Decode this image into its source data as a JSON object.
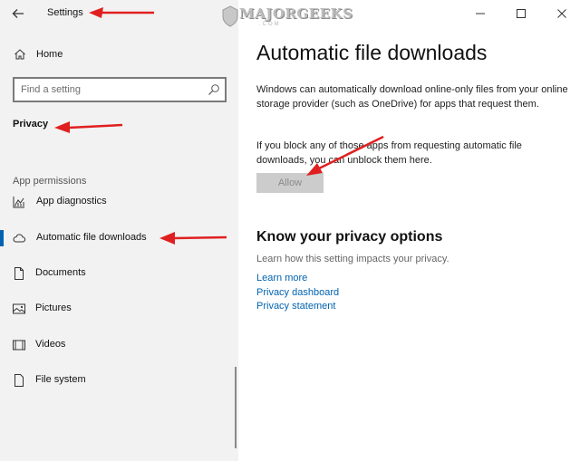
{
  "window": {
    "title": "Settings",
    "back_icon": "arrow-left-icon",
    "caption_icons": [
      "minimize-icon",
      "maximize-icon",
      "close-icon"
    ]
  },
  "sidebar": {
    "home_label": "Home",
    "search_placeholder": "Find a setting",
    "section_privacy": "Privacy",
    "section_permissions": "App permissions",
    "items": [
      {
        "label": "App diagnostics",
        "icon": "diagnostics-icon"
      },
      {
        "label": "Automatic file downloads",
        "icon": "cloud-icon",
        "selected": true
      },
      {
        "label": "Documents",
        "icon": "document-icon"
      },
      {
        "label": "Pictures",
        "icon": "picture-icon"
      },
      {
        "label": "Videos",
        "icon": "video-icon"
      },
      {
        "label": "File system",
        "icon": "file-icon"
      }
    ]
  },
  "main": {
    "title": "Automatic file downloads",
    "paragraph1": "Windows can automatically download online-only files from your online storage provider (such as OneDrive) for apps that request them.",
    "paragraph2": "If you block any of those apps from requesting automatic file downloads, you can unblock them here.",
    "allow_label": "Allow",
    "privacy_title": "Know your privacy options",
    "privacy_text": "Learn how this setting impacts your privacy.",
    "links": [
      "Learn more",
      "Privacy dashboard",
      "Privacy statement"
    ]
  },
  "watermark": {
    "text": "MAJORGEEKS",
    "suffix": ".COM"
  },
  "colors": {
    "accent": "#0063b1",
    "annotation": "#e02020",
    "sidebar_bg": "#f2f2f2"
  }
}
